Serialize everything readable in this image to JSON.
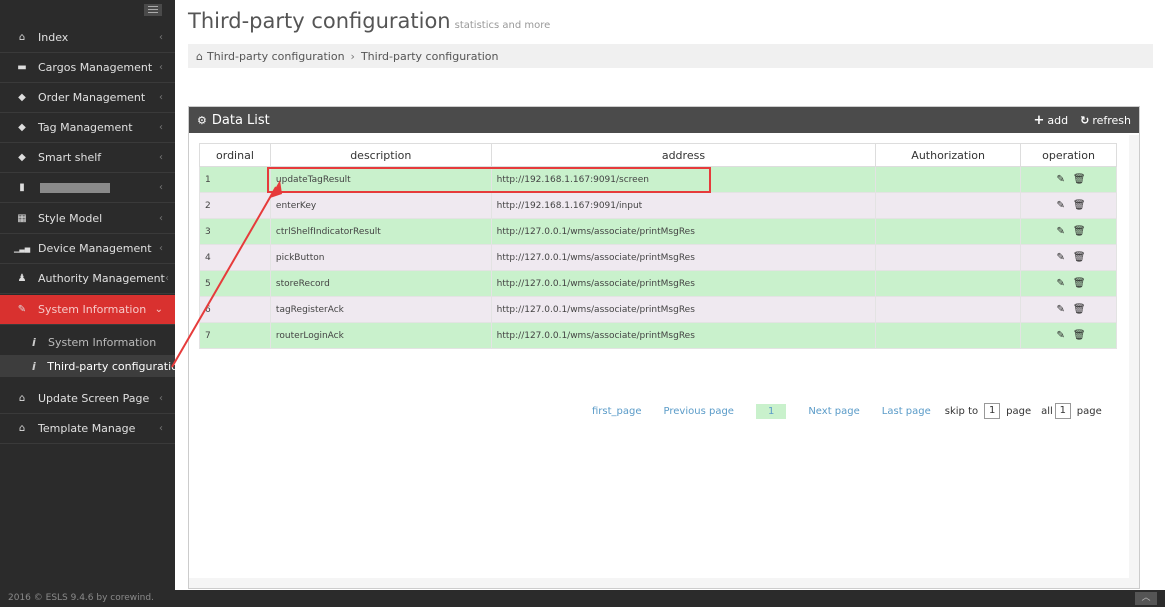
{
  "sidebar": {
    "items": [
      {
        "icon": "home-icon",
        "glyph": "⌂",
        "label": "Index"
      },
      {
        "icon": "folder-icon",
        "glyph": "▬",
        "label": "Cargos Management"
      },
      {
        "icon": "tag-icon",
        "glyph": "◆",
        "label": "Order Management"
      },
      {
        "icon": "tags-icon",
        "glyph": "◆",
        "label": "Tag Management"
      },
      {
        "icon": "tag-icon",
        "glyph": "◆",
        "label": "Smart shelf"
      },
      {
        "icon": "blurred-icon",
        "glyph": "▮",
        "label": ""
      },
      {
        "icon": "grid-icon",
        "glyph": "▦",
        "label": "Style Model"
      },
      {
        "icon": "bar-chart-icon",
        "glyph": "▁▃▅",
        "label": "Device Management"
      },
      {
        "icon": "user-icon",
        "glyph": "♟",
        "label": "Authority Management"
      },
      {
        "icon": "edit-icon",
        "glyph": "✎",
        "label": "System Information"
      },
      {
        "icon": "home-icon",
        "glyph": "⌂",
        "label": "Update Screen Page"
      },
      {
        "icon": "home-icon",
        "glyph": "⌂",
        "label": "Template Manage"
      }
    ],
    "subitems": [
      {
        "label": "System Information"
      },
      {
        "label": "Third-party configuration"
      }
    ]
  },
  "header": {
    "title": "Third-party configuration",
    "subtitle": "statistics and more"
  },
  "breadcrumb": {
    "items": [
      "Third-party configuration",
      "Third-party configuration"
    ]
  },
  "panel": {
    "title": "Data List",
    "add_label": "add",
    "refresh_label": "refresh"
  },
  "table": {
    "columns": [
      "ordinal",
      "description",
      "address",
      "Authorization",
      "operation"
    ],
    "rows": [
      {
        "ordinal": "1",
        "description": "updateTagResult",
        "address": "http://192.168.1.167:9091/screen",
        "authorization": ""
      },
      {
        "ordinal": "2",
        "description": "enterKey",
        "address": "http://192.168.1.167:9091/input",
        "authorization": ""
      },
      {
        "ordinal": "3",
        "description": "ctrlShelfIndicatorResult",
        "address": "http://127.0.0.1/wms/associate/printMsgRes",
        "authorization": ""
      },
      {
        "ordinal": "4",
        "description": "pickButton",
        "address": "http://127.0.0.1/wms/associate/printMsgRes",
        "authorization": ""
      },
      {
        "ordinal": "5",
        "description": "storeRecord",
        "address": "http://127.0.0.1/wms/associate/printMsgRes",
        "authorization": ""
      },
      {
        "ordinal": "6",
        "description": "tagRegisterAck",
        "address": "http://127.0.0.1/wms/associate/printMsgRes",
        "authorization": ""
      },
      {
        "ordinal": "7",
        "description": "routerLoginAck",
        "address": "http://127.0.0.1/wms/associate/printMsgRes",
        "authorization": ""
      }
    ]
  },
  "pager": {
    "first": "first_page",
    "prev": "Previous page",
    "current": "1",
    "next": "Next page",
    "last": "Last page",
    "skip_to": "skip to",
    "skip_value": "1",
    "page": "page",
    "all": "all",
    "total": "1"
  },
  "footer": {
    "text": "2016 © ESLS 9.4.6 by corewind."
  },
  "colors": {
    "sidebar_bg": "#2b2b2b",
    "active_red": "#d9312f",
    "row_green": "#c9f1cc",
    "row_lavender": "#efe9f0",
    "highlight_red": "#e63b3b"
  }
}
